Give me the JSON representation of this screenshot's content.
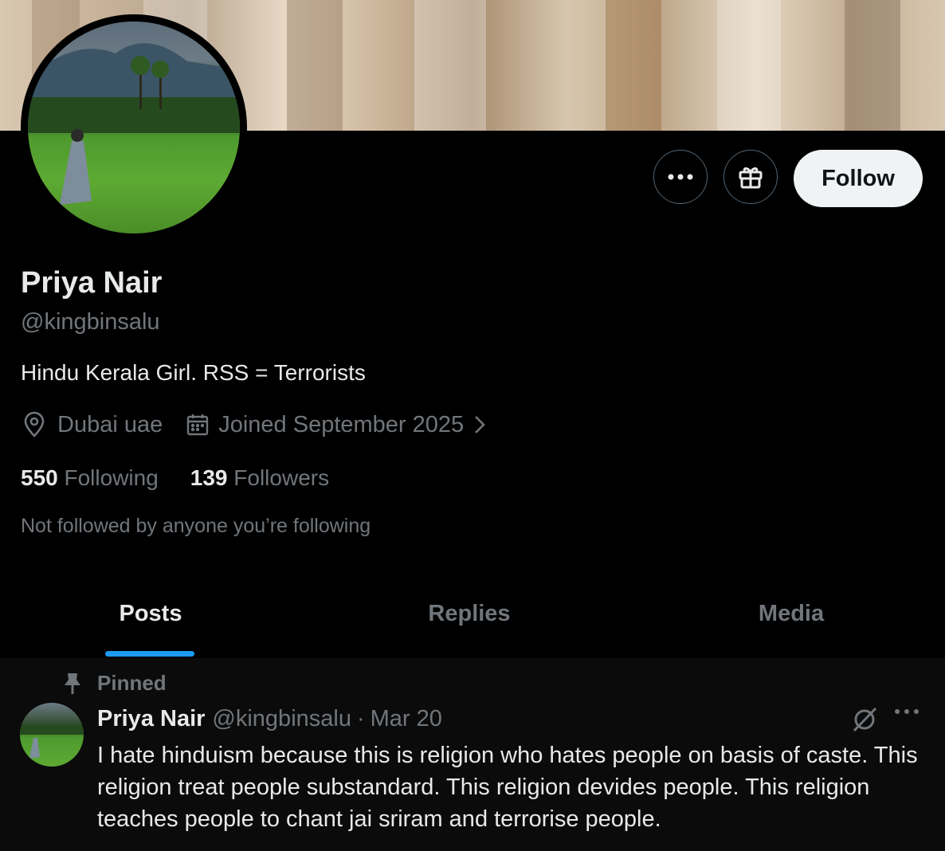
{
  "profile": {
    "name": "Priya Nair",
    "handle": "@kingbinsalu",
    "bio": "Hindu Kerala Girl. RSS = Terrorists",
    "location": "Dubai uae",
    "joined": "Joined September 2025",
    "following_count": "550",
    "following_label": "Following",
    "followers_count": "139",
    "followers_label": "Followers",
    "not_followed_note": "Not followed by anyone you’re following"
  },
  "actions": {
    "more_icon": "more-icon",
    "gift_icon": "gift-icon",
    "follow_label": "Follow"
  },
  "tabs": [
    {
      "label": "Posts",
      "active": true
    },
    {
      "label": "Replies",
      "active": false
    },
    {
      "label": "Media",
      "active": false
    }
  ],
  "pinned_post": {
    "pinned_label": "Pinned",
    "author_name": "Priya Nair",
    "author_handle": "@kingbinsalu",
    "separator": "·",
    "date": "Mar 20",
    "text": "I hate hinduism because this is religion who hates people on basis of caste. This religion treat people substandard. This religion devides people. This religion teaches people to chant jai sriram and terrorise people."
  },
  "colors": {
    "background": "#000000",
    "text_primary": "#e7e9ea",
    "text_secondary": "#71767b",
    "accent": "#1d9bf0",
    "follow_bg": "#eff3f4"
  }
}
